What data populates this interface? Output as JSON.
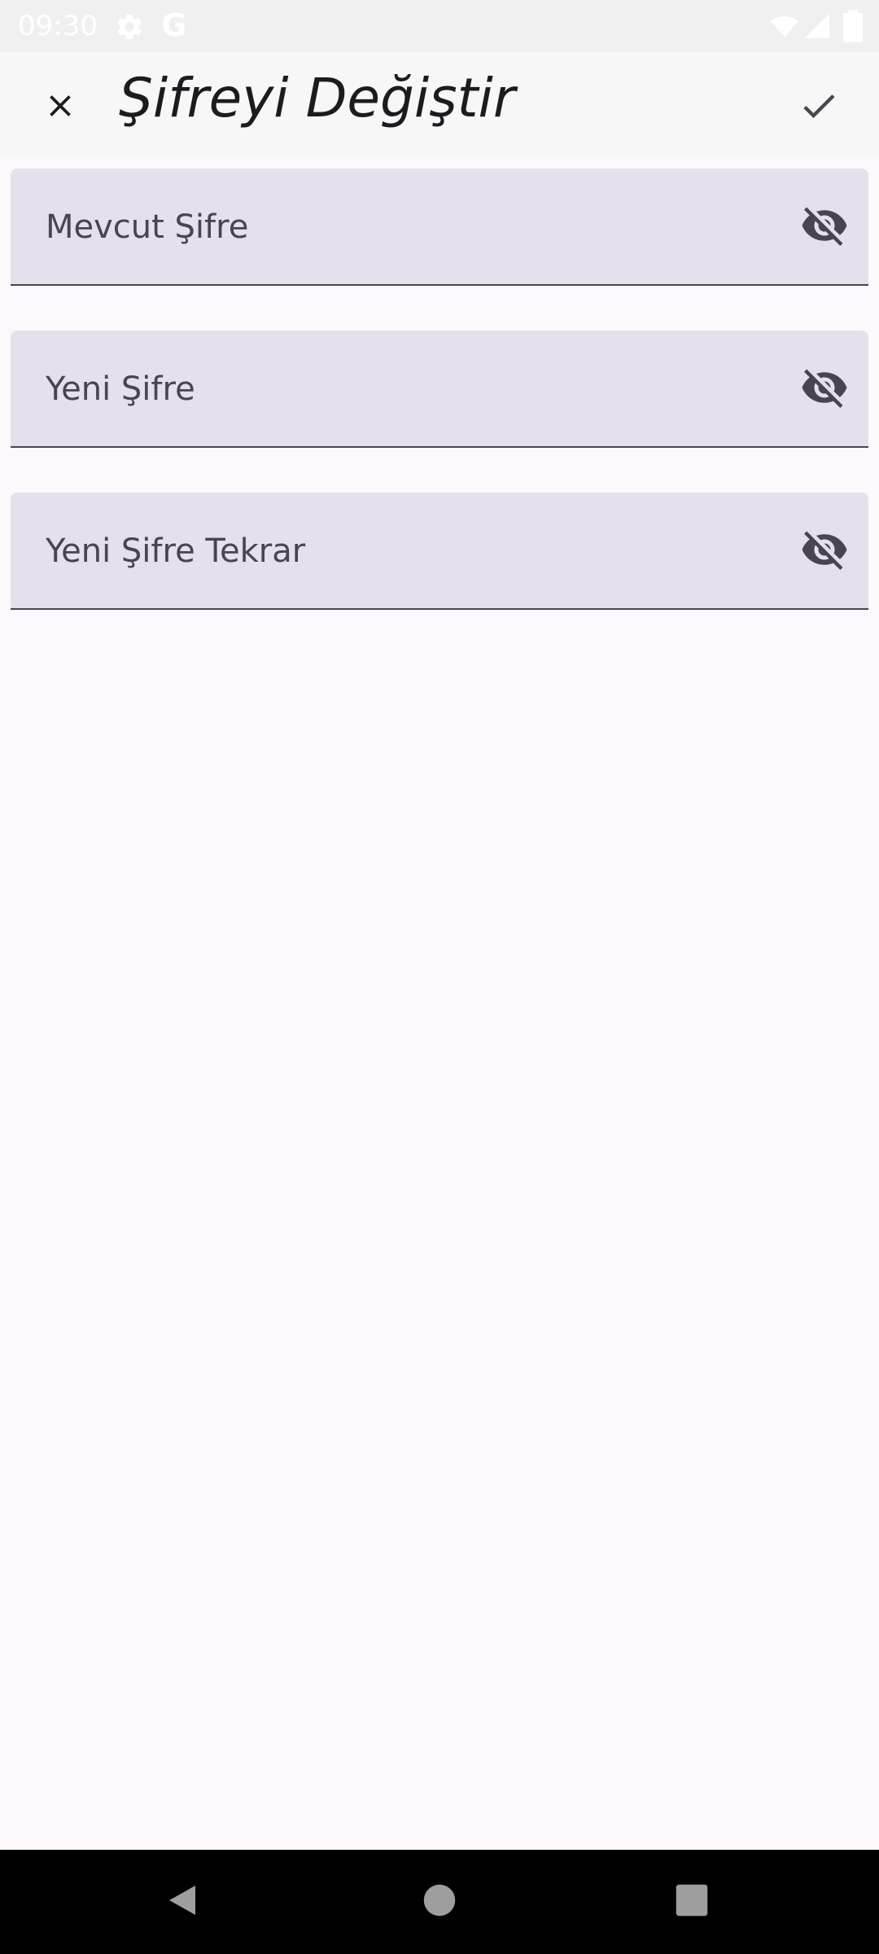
{
  "status_bar": {
    "time": "09:30",
    "icons": [
      "settings-icon",
      "google-icon",
      "wifi-off-icon",
      "signal-icon",
      "battery-icon"
    ],
    "google_letter": "G"
  },
  "app_bar": {
    "title": "Şifreyi Değiştir",
    "close_icon": "close-icon",
    "confirm_icon": "check-icon"
  },
  "form": {
    "fields": [
      {
        "label": "Mevcut Şifre",
        "icon": "visibility-off-icon"
      },
      {
        "label": "Yeni Şifre",
        "icon": "visibility-off-icon"
      },
      {
        "label": "Yeni Şifre Tekrar",
        "icon": "visibility-off-icon"
      }
    ]
  },
  "nav_bar": {
    "icons": [
      "back-icon",
      "home-icon",
      "recents-icon"
    ]
  },
  "colors": {
    "background": "#fdf8fc",
    "field_fill": "#e6dfec",
    "field_text": "#49454f",
    "title_text": "#1c1b1f",
    "app_bar": "#f7f7f7",
    "nav_bar": "#000000"
  }
}
